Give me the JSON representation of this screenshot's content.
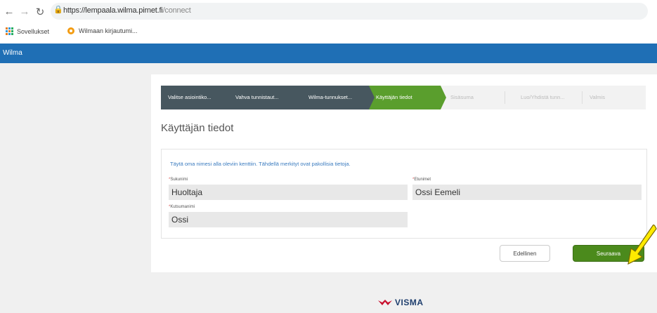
{
  "browser": {
    "url_host": "https://lempaala.wilma.pirnet.fi",
    "url_path": "/connect",
    "bookmarks": [
      {
        "label": "Sovellukset"
      },
      {
        "label": "Wilmaan kirjautumi..."
      }
    ]
  },
  "header": {
    "title": "Wilma",
    "color": "#1f6fb5"
  },
  "steps": [
    {
      "label": "Valitse asiointiko...",
      "state": "done"
    },
    {
      "label": "Vahva tunnistaut...",
      "state": "done"
    },
    {
      "label": "Wilma-tunnukset...",
      "state": "done"
    },
    {
      "label": "Käyttäjän tiedot",
      "state": "active"
    },
    {
      "label": "Sisäsuma",
      "state": "future"
    },
    {
      "label": "Luo/Yhdistä tunn...",
      "state": "future"
    },
    {
      "label": "Valmis",
      "state": "future"
    }
  ],
  "page": {
    "title": "Käyttäjän tiedot",
    "info": "Täytä oma nimesi alla oleviin kenttiin. Tähdellä merkityt ovat pakollisia tietoja."
  },
  "form": {
    "sukunimi": {
      "label": "Sukunimi",
      "value": "Huoltaja"
    },
    "etunimet": {
      "label": "Etunimet",
      "value": "Ossi Eemeli"
    },
    "kutsumanimi": {
      "label": "Kutsumanimi",
      "value": "Ossi"
    }
  },
  "buttons": {
    "prev": "Edellinen",
    "next": "Seuraava"
  },
  "footer": {
    "logo": "VISMA"
  },
  "colors": {
    "accent_green": "#5a9e2d",
    "step_done": "#47575f",
    "annotation_arrow": "#ffea00"
  }
}
